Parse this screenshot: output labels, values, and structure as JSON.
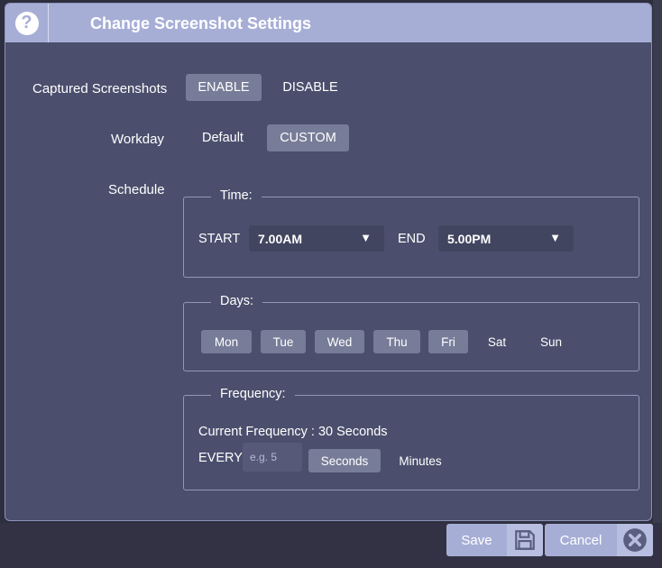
{
  "dialog": {
    "title": "Change Screenshot Settings",
    "help_icon": "?"
  },
  "captured": {
    "label": "Captured Screenshots",
    "enable": "ENABLE",
    "disable": "DISABLE",
    "selected": "ENABLE"
  },
  "workday": {
    "label": "Workday",
    "default": "Default",
    "custom": "CUSTOM",
    "selected": "CUSTOM"
  },
  "schedule": {
    "label": "Schedule",
    "time": {
      "legend": "Time:",
      "start_label": "START",
      "start_value": "7.00AM",
      "end_label": "END",
      "end_value": "5.00PM",
      "caret": "▼"
    },
    "days": {
      "legend": "Days:",
      "items": [
        {
          "label": "Mon",
          "selected": true
        },
        {
          "label": "Tue",
          "selected": true
        },
        {
          "label": "Wed",
          "selected": true
        },
        {
          "label": "Thu",
          "selected": true
        },
        {
          "label": "Fri",
          "selected": true
        },
        {
          "label": "Sat",
          "selected": false
        },
        {
          "label": "Sun",
          "selected": false
        }
      ]
    },
    "frequency": {
      "legend": "Frequency:",
      "current": "Current Frequency : 30 Seconds",
      "every_label": "EVERY",
      "placeholder": "e.g. 5",
      "seconds": "Seconds",
      "minutes": "Minutes",
      "selected_unit": "Seconds"
    }
  },
  "footer": {
    "save_label": "Save",
    "save_icon": "floppy-disk-icon",
    "cancel_label": "Cancel",
    "cancel_icon": "close-circle-icon"
  },
  "colors": {
    "dialog_bg": "#4b4f6d",
    "titlebar": "#a7aed6",
    "selected_button": "#777c98"
  }
}
